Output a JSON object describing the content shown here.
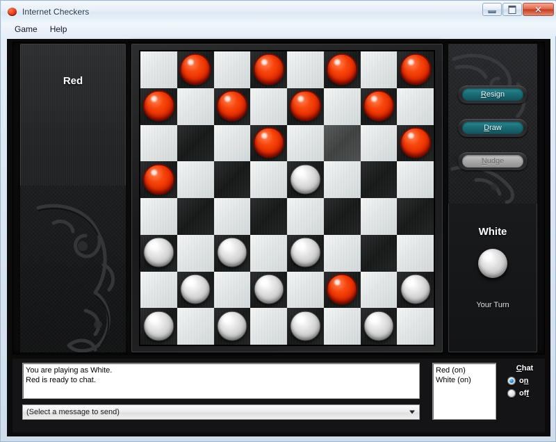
{
  "window": {
    "title": "Internet Checkers",
    "icon": "red-checker-icon",
    "controls": {
      "minimize": "minimize-button",
      "maximize": "maximize-button",
      "close_glyph": "✕"
    }
  },
  "menubar": {
    "items": [
      {
        "label": "Game"
      },
      {
        "label": "Help"
      }
    ]
  },
  "left_panel": {
    "player_name": "Red"
  },
  "right_panel": {
    "buttons": [
      {
        "label": "Resign",
        "accel": "R",
        "rest": "esign",
        "enabled": true
      },
      {
        "label": "Draw",
        "accel": "D",
        "rest": "raw",
        "enabled": true
      },
      {
        "label": "Nudge",
        "accel": "N",
        "rest": "udge",
        "enabled": false
      }
    ],
    "player_name": "White",
    "piece_color": "white",
    "status": "Your Turn"
  },
  "board": {
    "size": 8,
    "light_color": "#e6eaeb",
    "dark_color": "#1d1e1f",
    "highlight_square": {
      "row": 2,
      "col": 5
    },
    "pieces": [
      {
        "row": 0,
        "col": 1,
        "color": "red"
      },
      {
        "row": 0,
        "col": 3,
        "color": "red"
      },
      {
        "row": 0,
        "col": 5,
        "color": "red"
      },
      {
        "row": 0,
        "col": 7,
        "color": "red"
      },
      {
        "row": 1,
        "col": 0,
        "color": "red"
      },
      {
        "row": 1,
        "col": 2,
        "color": "red"
      },
      {
        "row": 1,
        "col": 4,
        "color": "red"
      },
      {
        "row": 1,
        "col": 6,
        "color": "red"
      },
      {
        "row": 2,
        "col": 3,
        "color": "red"
      },
      {
        "row": 2,
        "col": 7,
        "color": "red"
      },
      {
        "row": 3,
        "col": 0,
        "color": "red"
      },
      {
        "row": 3,
        "col": 4,
        "color": "white"
      },
      {
        "row": 5,
        "col": 0,
        "color": "white"
      },
      {
        "row": 5,
        "col": 2,
        "color": "white"
      },
      {
        "row": 5,
        "col": 4,
        "color": "white"
      },
      {
        "row": 6,
        "col": 1,
        "color": "white"
      },
      {
        "row": 6,
        "col": 3,
        "color": "white"
      },
      {
        "row": 6,
        "col": 5,
        "color": "red"
      },
      {
        "row": 6,
        "col": 7,
        "color": "white"
      },
      {
        "row": 7,
        "col": 0,
        "color": "white"
      },
      {
        "row": 7,
        "col": 2,
        "color": "white"
      },
      {
        "row": 7,
        "col": 4,
        "color": "white"
      },
      {
        "row": 7,
        "col": 6,
        "color": "white"
      }
    ]
  },
  "chat": {
    "log_lines": [
      "You are playing as White.",
      "Red is ready to chat."
    ],
    "message_select_value": "(Select a message to send)",
    "players": [
      "Red (on)",
      "White (on)"
    ],
    "header": "Chat",
    "header_accel": "C",
    "header_rest": "hat",
    "options": [
      {
        "label": "on",
        "accel_tail": "n",
        "head": "o",
        "selected": true
      },
      {
        "label": "off",
        "accel_tail": "f",
        "head": "of",
        "selected": false
      }
    ]
  },
  "colors": {
    "accent_teal": "#1a6b75",
    "red_piece": "#f23c05",
    "white_piece": "#d6d6d6",
    "titlebar": "#e6eef7",
    "close_red": "#c43c21",
    "radio_blue": "#1a7fd4"
  }
}
